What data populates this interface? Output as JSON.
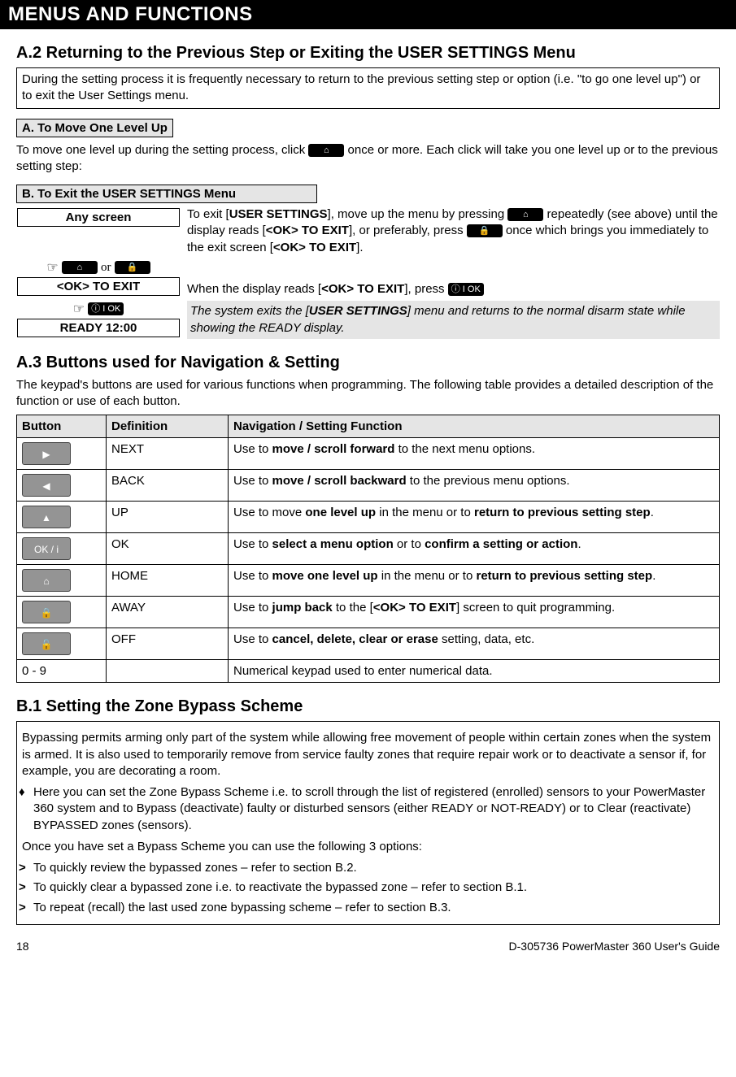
{
  "header": {
    "title": "MENUS AND FUNCTIONS"
  },
  "a2": {
    "heading": "A.2 Returning to the Previous Step or Exiting the USER SETTINGS Menu",
    "intro": "During the setting process it is frequently necessary to return to the previous setting step or option (i.e. \"to go one level up\") or to exit the User Settings menu.",
    "sub_a": "A. To Move One Level Up",
    "move_up_pre": "To move one level up during the setting process, click ",
    "move_up_post": " once or more. Each click will take you one level up or to the previous setting step:",
    "sub_b": "B. To Exit the USER SETTINGS Menu",
    "screen_any": "Any screen",
    "exit_pre": "To exit [",
    "exit_us": "USER SETTINGS",
    "exit_mid1": "], move up the menu by pressing ",
    "exit_mid2": " repeatedly (see above) until the display reads [",
    "ok_to_exit": "<OK> TO EXIT",
    "exit_mid3": "], or preferably, press ",
    "exit_mid4": " once which brings you immediately to the exit screen [",
    "exit_mid5": "].",
    "or": "or",
    "screen_ok": "<OK> TO EXIT",
    "when_pre": "When the display reads [",
    "when_mid": "], press ",
    "ok_icon": "ⓘ I OK",
    "screen_ready": "READY 12:00",
    "result_pre": "The system exits the [",
    "result_us": "USER SETTINGS",
    "result_post": "] menu and returns to the normal disarm state while showing the READY display."
  },
  "a3": {
    "heading": "A.3 Buttons used for Navigation & Setting",
    "intro": "The keypad's buttons are used for various functions when programming. The following table provides a detailed description of the function or use of each button.",
    "cols": {
      "c1": "Button",
      "c2": "Definition",
      "c3": "Navigation / Setting Function"
    },
    "rows": [
      {
        "icon": "▶",
        "def": "NEXT",
        "fn_pre": "Use to ",
        "fn_b": "move / scroll forward",
        "fn_post": " to the next menu options."
      },
      {
        "icon": "◀",
        "def": "BACK",
        "fn_pre": "Use to ",
        "fn_b": "move / scroll backward",
        "fn_post": " to the previous menu options."
      },
      {
        "icon": "▲",
        "def": "UP",
        "fn_pre": "Use to move ",
        "fn_b": "one level up",
        "fn_mid": " in the menu or to ",
        "fn_b2": "return to previous setting step",
        "fn_post": "."
      },
      {
        "icon": "OK / i",
        "def": "OK",
        "fn_pre": "Use to ",
        "fn_b": "select a menu option",
        "fn_mid": " or to ",
        "fn_b2": "confirm a setting or action",
        "fn_post": "."
      },
      {
        "icon": "⌂",
        "def": "HOME",
        "fn_pre": "Use to ",
        "fn_b": "move one level up",
        "fn_mid": " in the menu or to ",
        "fn_b2": "return to previous setting step",
        "fn_post": "."
      },
      {
        "icon": "🔒",
        "def": "AWAY",
        "fn_pre": "Use to ",
        "fn_b": "jump back",
        "fn_mid": " to the [",
        "fn_b2": "<OK> TO EXIT",
        "fn_post": "] screen to quit programming."
      },
      {
        "icon": "🔓",
        "def": "OFF",
        "fn_pre": "Use to ",
        "fn_b": "cancel, delete, clear or erase",
        "fn_post": " setting, data, etc."
      },
      {
        "icon_text": "0 - 9",
        "def": "",
        "fn_plain": "Numerical keypad used to enter numerical data."
      }
    ]
  },
  "b1": {
    "heading": "B.1 Setting the Zone Bypass Scheme",
    "p1": "Bypassing permits arming only part of the system while allowing free movement of people within certain zones when the system is armed. It is also used to temporarily remove from service faulty zones that require repair work or to deactivate a sensor if, for example, you are decorating a room.",
    "d1": "Here you can set the Zone Bypass Scheme i.e. to scroll through the list of registered (enrolled) sensors to your PowerMaster 360 system and to Bypass (deactivate) faulty or disturbed sensors (either READY or NOT-READY) or to Clear (reactivate) BYPASSED zones (sensors).",
    "p2": "Once you have set a Bypass Scheme you can use the following 3 options:",
    "c1": "To quickly review the bypassed zones – refer to section B.2.",
    "c2": "To quickly clear a bypassed zone i.e. to reactivate the bypassed zone – refer to section B.1.",
    "c3": "To repeat (recall) the last used zone bypassing scheme – refer to section B.3."
  },
  "footer": {
    "page": "18",
    "doc": "D-305736 PowerMaster 360 User's Guide"
  },
  "icons": {
    "home": "⌂",
    "away": "🔒"
  }
}
